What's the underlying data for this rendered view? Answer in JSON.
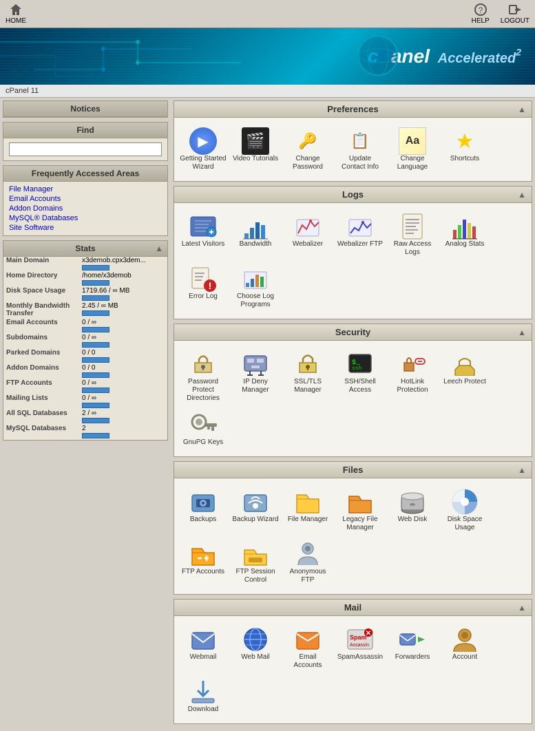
{
  "topnav": {
    "home_label": "HOME",
    "help_label": "HELP",
    "logout_label": "LOGOUT"
  },
  "breadcrumb": "cPanel 11",
  "sidebar": {
    "notices_title": "Notices",
    "find_title": "Find",
    "find_placeholder": "",
    "freq_title": "Frequently Accessed Areas",
    "freq_links": [
      "File Manager",
      "Email Accounts",
      "Addon Domains",
      "MySQL® Databases",
      "Site Software"
    ],
    "stats_title": "Stats",
    "stats": [
      {
        "label": "Main Domain",
        "value": "x3demob.cpx3dem..."
      },
      {
        "label": "Home Directory",
        "value": "/home/x3demob"
      },
      {
        "label": "Disk Space Usage",
        "value": "1719.66 / ∞ MB"
      },
      {
        "label": "Monthly Bandwidth Transfer",
        "value": "2.45 / ∞ MB"
      },
      {
        "label": "Email Accounts",
        "value": "0 / ∞"
      },
      {
        "label": "Subdomains",
        "value": "0 / ∞"
      },
      {
        "label": "Parked Domains",
        "value": "0 / 0"
      },
      {
        "label": "Addon Domains",
        "value": "0 / 0"
      },
      {
        "label": "FTP Accounts",
        "value": "0 / ∞"
      },
      {
        "label": "Mailing Lists",
        "value": "0 / ∞"
      },
      {
        "label": "All SQL Databases",
        "value": "2 / ∞"
      },
      {
        "label": "MySQL Databases",
        "value": "2"
      }
    ]
  },
  "sections": {
    "preferences": {
      "title": "Preferences",
      "items": [
        {
          "label": "Getting Started Wizard",
          "icon": "▶",
          "icon_type": "play"
        },
        {
          "label": "Video Tutorials",
          "icon": "🎬",
          "icon_type": "film"
        },
        {
          "label": "Change Password",
          "icon": "🔑",
          "icon_type": "key"
        },
        {
          "label": "Update Contact Info",
          "icon": "📋",
          "icon_type": "contact"
        },
        {
          "label": "Change Language",
          "icon": "Aa",
          "icon_type": "text"
        },
        {
          "label": "Shortcuts",
          "icon": "⭐",
          "icon_type": "star"
        }
      ]
    },
    "logs": {
      "title": "Logs",
      "items": [
        {
          "label": "Latest Visitors",
          "icon": "👥",
          "icon_type": "visitors"
        },
        {
          "label": "Bandwidth",
          "icon": "📊",
          "icon_type": "bandwidth"
        },
        {
          "label": "Webalizer",
          "icon": "📈",
          "icon_type": "webalizer"
        },
        {
          "label": "Webalizer FTP",
          "icon": "📈",
          "icon_type": "webalizer-ftp"
        },
        {
          "label": "Raw Access Logs",
          "icon": "📄",
          "icon_type": "raw-log"
        },
        {
          "label": "Analog Stats",
          "icon": "📊",
          "icon_type": "analog"
        },
        {
          "label": "Error Log",
          "icon": "⚠",
          "icon_type": "error"
        },
        {
          "label": "Choose Log Programs",
          "icon": "📊",
          "icon_type": "choose-log"
        }
      ]
    },
    "security": {
      "title": "Security",
      "items": [
        {
          "label": "Password Protect Directories",
          "icon": "🔒",
          "icon_type": "lock-folder"
        },
        {
          "label": "IP Deny Manager",
          "icon": "🚫",
          "icon_type": "ip-deny"
        },
        {
          "label": "SSL/TLS Manager",
          "icon": "🔐",
          "icon_type": "ssl"
        },
        {
          "label": "SSH/Shell Access",
          "icon": "💻",
          "icon_type": "ssh"
        },
        {
          "label": "HotLink Protection",
          "icon": "🔗",
          "icon_type": "hotlink"
        },
        {
          "label": "Leech Protect",
          "icon": "📁",
          "icon_type": "leech"
        },
        {
          "label": "GnuPG Keys",
          "icon": "🔑",
          "icon_type": "gnupg"
        }
      ]
    },
    "files": {
      "title": "Files",
      "items": [
        {
          "label": "Backups",
          "icon": "💾",
          "icon_type": "backup"
        },
        {
          "label": "Backup Wizard",
          "icon": "🧙",
          "icon_type": "backup-wizard"
        },
        {
          "label": "File Manager",
          "icon": "📁",
          "icon_type": "file-mgr"
        },
        {
          "label": "Legacy File Manager",
          "icon": "📁",
          "icon_type": "legacy-file"
        },
        {
          "label": "Web Disk",
          "icon": "💿",
          "icon_type": "web-disk"
        },
        {
          "label": "Disk Space Usage",
          "icon": "🥧",
          "icon_type": "disk-space"
        },
        {
          "label": "FTP Accounts",
          "icon": "📂",
          "icon_type": "ftp-accounts"
        },
        {
          "label": "FTP Session Control",
          "icon": "📂",
          "icon_type": "ftp-session"
        },
        {
          "label": "Anonymous FTP",
          "icon": "👤",
          "icon_type": "anon-ftp"
        }
      ]
    },
    "mail": {
      "title": "Mail",
      "items": [
        {
          "label": "Webmail",
          "icon": "✉",
          "icon_type": "webmail"
        },
        {
          "label": "Web Mail",
          "icon": "🌐",
          "icon_type": "webmail2"
        },
        {
          "label": "Email Accounts",
          "icon": "📧",
          "icon_type": "email"
        },
        {
          "label": "SpamAssassin",
          "icon": "🛡",
          "icon_type": "spam"
        },
        {
          "label": "Forwarders",
          "icon": "➡",
          "icon_type": "forwarders"
        },
        {
          "label": "Account",
          "icon": "👤",
          "icon_type": "account"
        },
        {
          "label": "Download",
          "icon": "⬇",
          "icon_type": "download"
        }
      ]
    }
  }
}
